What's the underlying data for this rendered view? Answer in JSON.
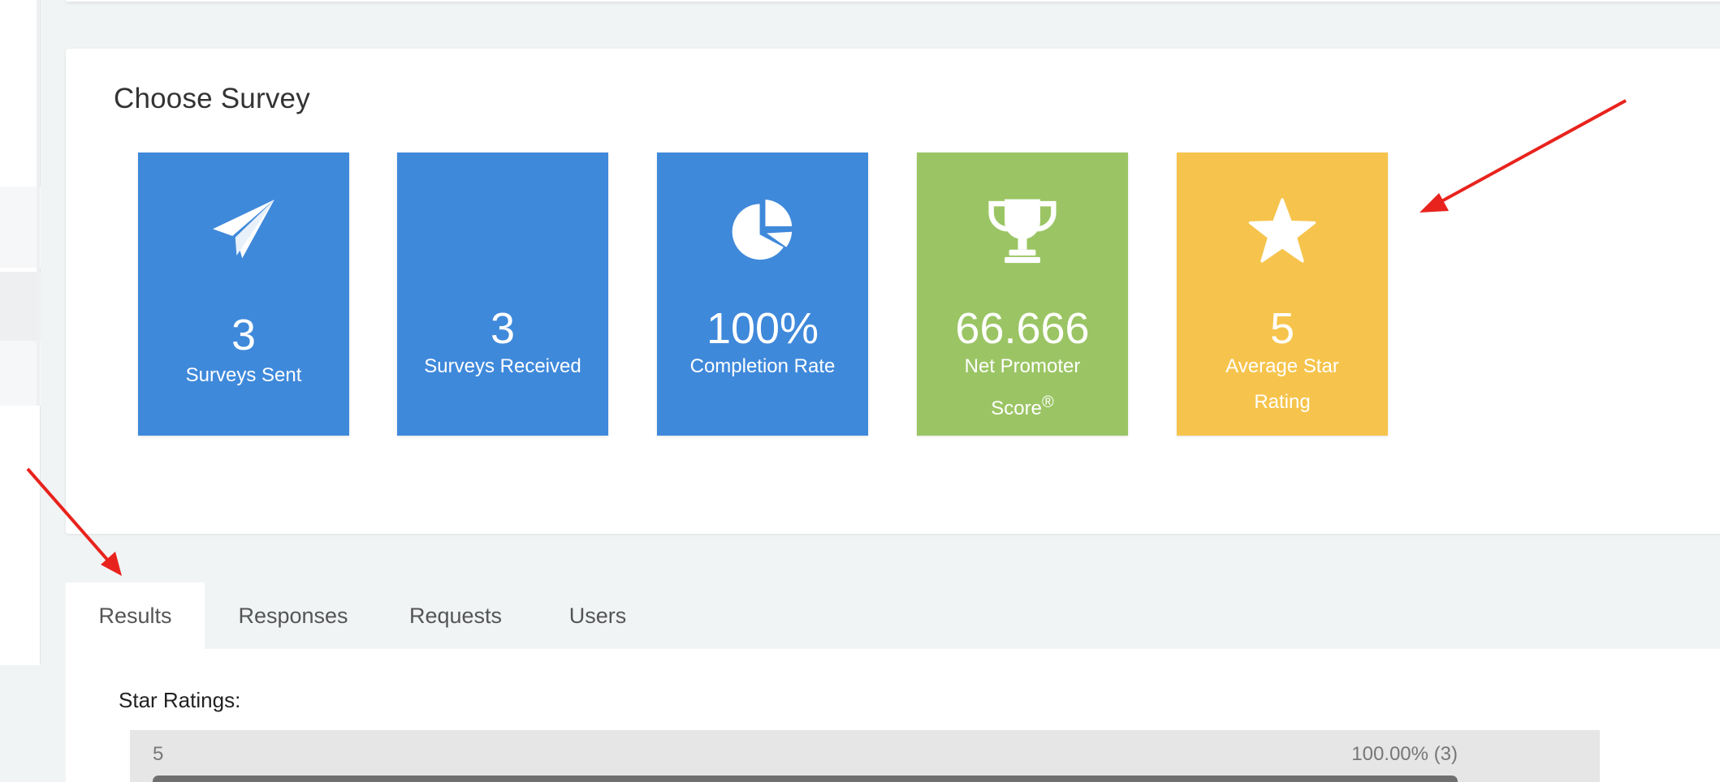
{
  "survey_panel": {
    "title": "Choose Survey"
  },
  "stats": [
    {
      "value": "3",
      "label": "Surveys Sent",
      "icon": "paper-plane-icon",
      "color": "#3f89db"
    },
    {
      "value": "3",
      "label": "Surveys Received",
      "color": "#3f89db"
    },
    {
      "value": "100%",
      "label": "Completion Rate",
      "icon": "pie-chart-icon",
      "color": "#3f89db"
    },
    {
      "value": "66.666",
      "label": "Net Promoter Score",
      "label_suffix": "®",
      "icon": "trophy-icon",
      "color": "#9bc564"
    },
    {
      "value": "5",
      "label": "Average Star Rating",
      "icon": "star-icon",
      "color": "#f6c44c"
    }
  ],
  "tabs": [
    {
      "label": "Results",
      "active": true
    },
    {
      "label": "Responses"
    },
    {
      "label": "Requests"
    },
    {
      "label": "Users"
    }
  ],
  "results": {
    "heading": "Star Ratings:",
    "ratings": [
      {
        "stars": "5",
        "percent_text": "100.00% (3)",
        "fraction": 1.0
      }
    ]
  },
  "annotations": {
    "arrow_color": "#e8231d"
  }
}
